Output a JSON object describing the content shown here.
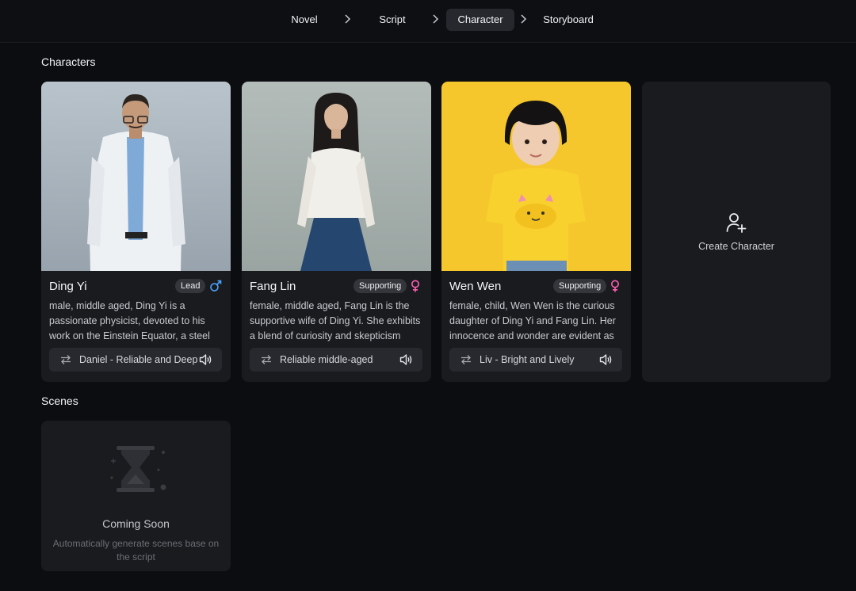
{
  "steps": [
    "Novel",
    "Script",
    "Character",
    "Storyboard"
  ],
  "active_step": "Character",
  "characters_section": {
    "title": "Characters"
  },
  "characters": [
    {
      "name": "Ding Yi",
      "role": "Lead",
      "gender": "male",
      "description": "male, middle aged, Ding Yi is a passionate physicist, devoted to his work on the Einstein Equator, a steel",
      "voice": "Daniel - Reliable and Deep"
    },
    {
      "name": "Fang Lin",
      "role": "Supporting",
      "gender": "female",
      "description": "female, middle aged, Fang Lin is the supportive wife of Ding Yi. She exhibits a blend of curiosity and skepticism",
      "voice": "Reliable middle-aged"
    },
    {
      "name": "Wen Wen",
      "role": "Supporting",
      "gender": "female",
      "description": "female, child, Wen Wen is the curious daughter of Ding Yi and Fang Lin. Her innocence and wonder are evident as",
      "voice": "Liv - Bright and Lively"
    }
  ],
  "create_character": {
    "label": "Create Character"
  },
  "scenes_section": {
    "title": "Scenes"
  },
  "coming_soon": {
    "title": "Coming Soon",
    "subtitle": "Automatically generate scenes base on the script"
  },
  "colors": {
    "background": "#0c0d11",
    "card": "#1a1b1f",
    "male_icon": "#4aa3ff",
    "female_icon": "#ff5fb4",
    "portrait_bg_ding_yi": "#aab4bd",
    "portrait_bg_fang_lin": "#a7b0ad",
    "portrait_bg_wen_wen": "#f5c72c"
  },
  "icons": [
    "chevron-right-icon",
    "male-icon",
    "female-icon",
    "swap-icon",
    "speaker-icon",
    "add-user-icon",
    "hourglass-icon"
  ]
}
